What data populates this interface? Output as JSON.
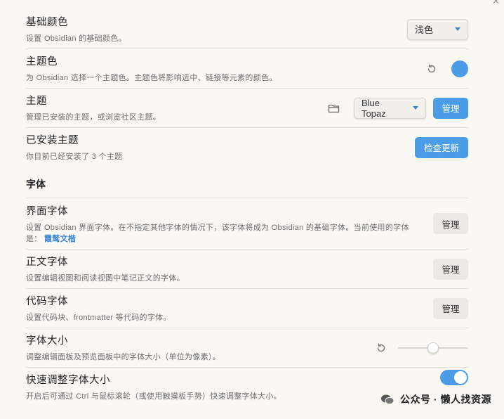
{
  "settings": {
    "base_color": {
      "name": "基础颜色",
      "desc": "设置 Obsidian 的基础颜色。",
      "value": "浅色"
    },
    "accent_color": {
      "name": "主题色",
      "desc": "为 Obsidian 选择一个主题色。主题色将影响选中、链接等元素的颜色。",
      "swatch": "#4a9de6",
      "reset_icon": "reset-icon"
    },
    "theme": {
      "name": "主题",
      "desc": "管理已安装的主题，或浏览社区主题。",
      "folder_icon": "folder-icon",
      "value": "Blue Topaz",
      "manage_label": "管理"
    },
    "installed_themes": {
      "name": "已安装主题",
      "desc": "你目前已经安装了 3 个主题",
      "check_label": "检查更新"
    },
    "fonts_heading": "字体",
    "interface_font": {
      "name": "界面字体",
      "desc": "设置 Obsidian 界面字体。在不指定其他字体的情况下，该字体将成为 Obsidian 的基础字体。当前使用的字体是：",
      "current_font": "霞鹜文楷",
      "manage_label": "管理"
    },
    "text_font": {
      "name": "正文字体",
      "desc": "设置编辑视图和阅读视图中笔记正文的字体。",
      "manage_label": "管理"
    },
    "code_font": {
      "name": "代码字体",
      "desc": "设置代码块、frontmatter 等代码的字体。",
      "manage_label": "管理"
    },
    "font_size": {
      "name": "字体大小",
      "desc": "调整编辑面板及预览面板中的字体大小（单位为像素）。",
      "slider_fraction": 0.5
    },
    "quick_font_size": {
      "name": "快速调整字体大小",
      "desc": "开启后可通过 Ctrl 与鼠标滚轮（或使用触摸板手势）快速调整字体大小。",
      "enabled": true
    }
  },
  "watermark": {
    "text": "公众号 · 懒人找资源"
  },
  "colors": {
    "accent": "#4a9de6",
    "background": "#faf8f2"
  }
}
